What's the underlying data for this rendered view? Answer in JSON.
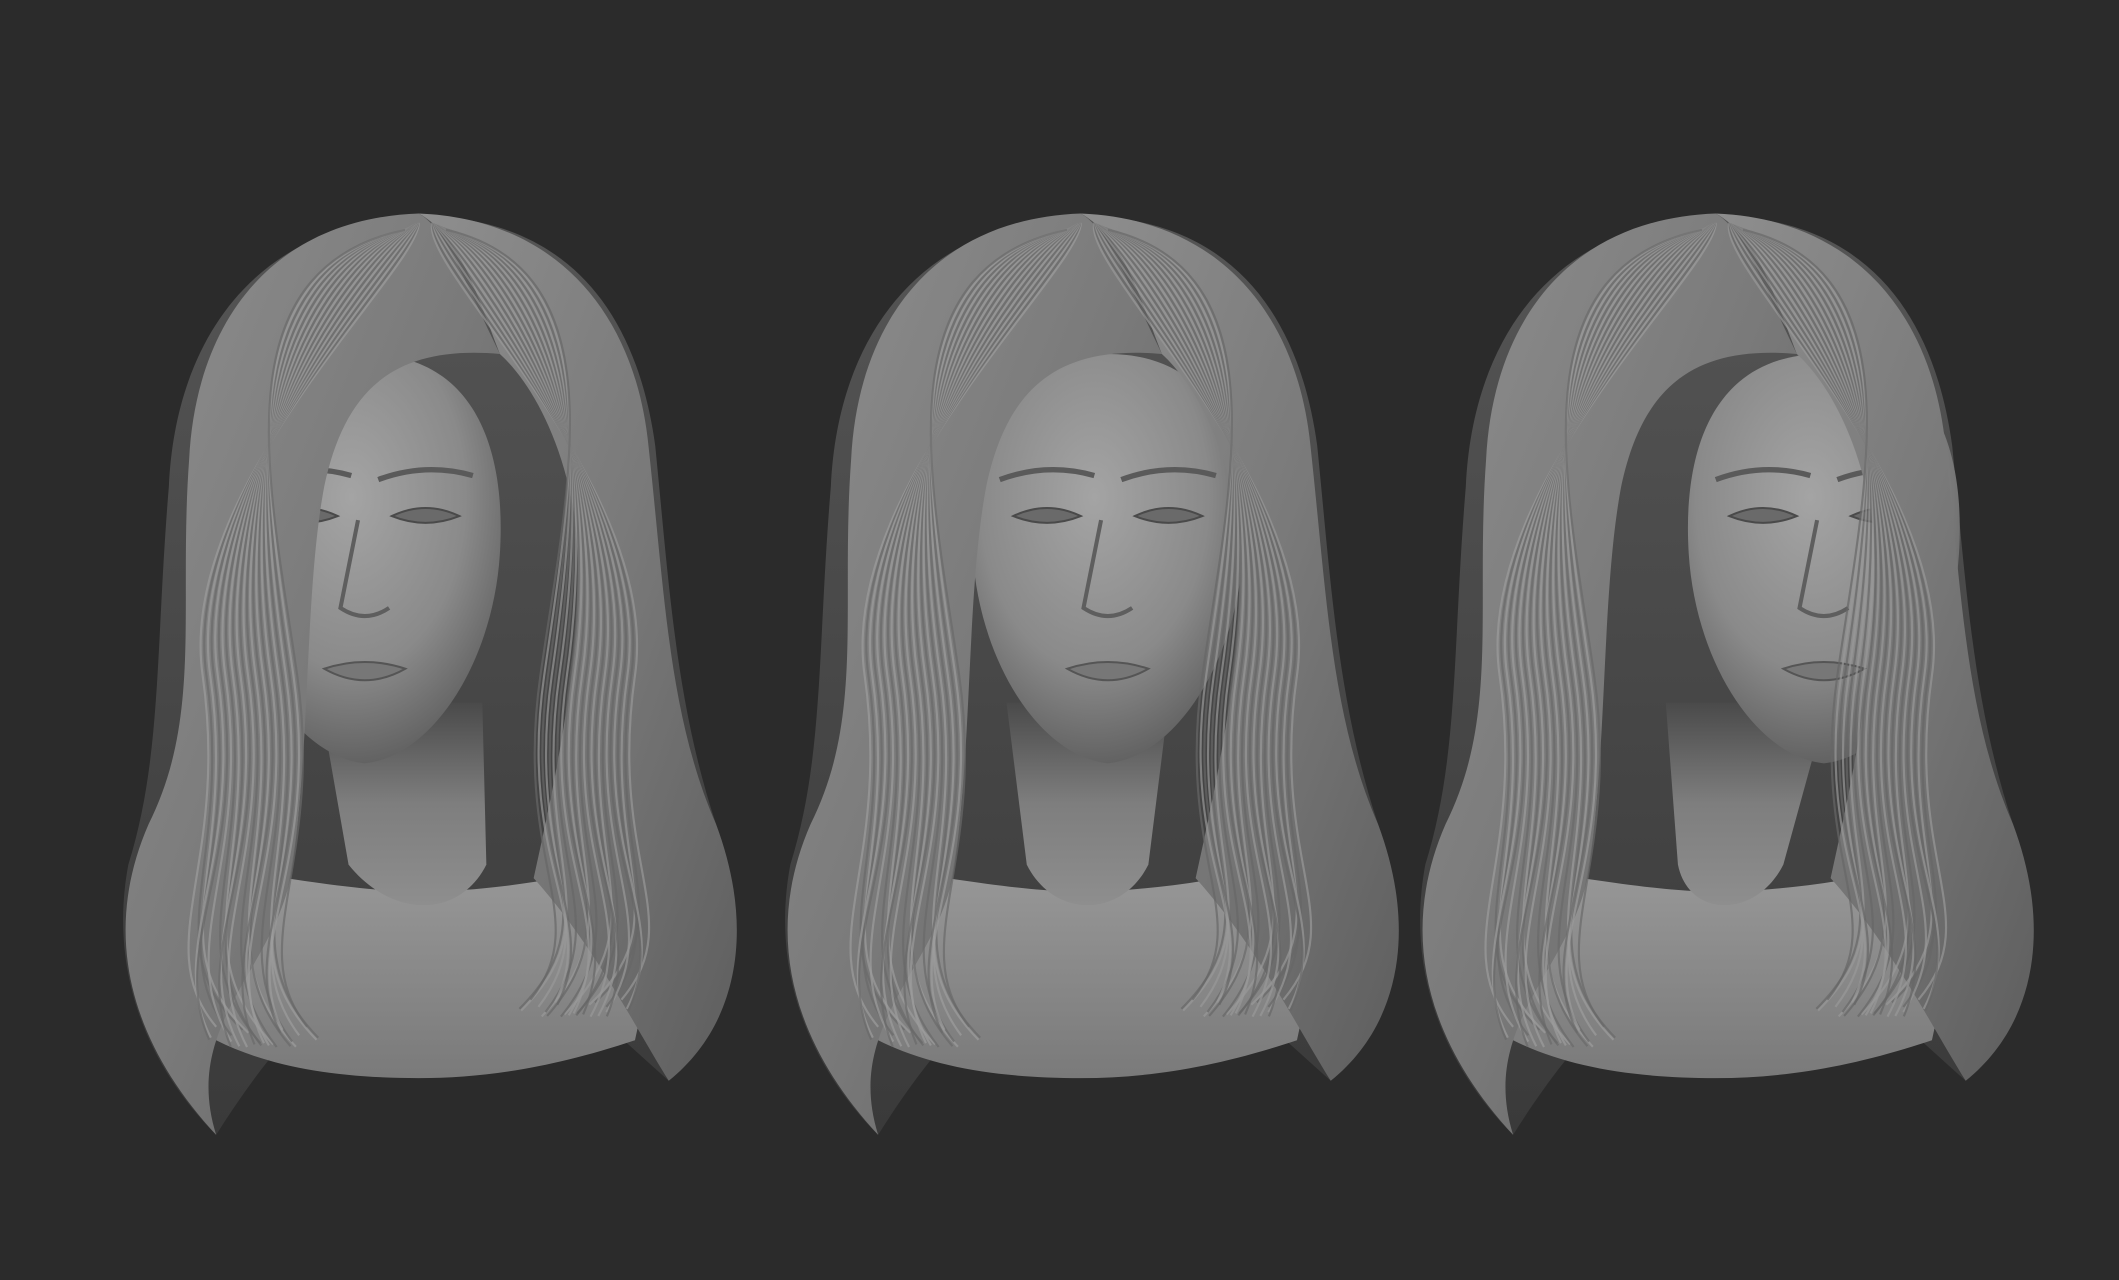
{
  "scene": {
    "background_color": "#2b2b2b",
    "material_color": "#8a8a8a",
    "views": [
      "three-quarter-left",
      "front",
      "three-quarter-right"
    ]
  }
}
